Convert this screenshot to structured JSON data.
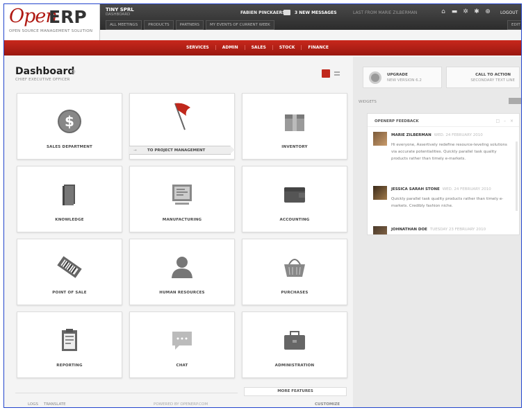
{
  "header": {
    "logo_open": "Open",
    "logo_erp": "ERP",
    "logo_tagline": "OPEN SOURCE MANAGEMENT SOLUTION",
    "db_name": "TINY SPRL",
    "db_sub": "DASHBOARD",
    "user_name": "FABIEN PINCKAERS",
    "messages": "3 NEW MESSAGES",
    "last_message": "LAST FROM MARIE ZILBERMAN",
    "logout": "LOGOUT",
    "edit": "EDIT",
    "subtabs": [
      "ALL MEETINGS",
      "PRODUCTS",
      "PARTNERS",
      "MY EVENTS OF CURRENT WEEK"
    ]
  },
  "menu": {
    "items": [
      "SERVICES",
      "ADMIN",
      "SALES",
      "STOCK",
      "FINANCE"
    ]
  },
  "dashboard": {
    "title": "Dashboard",
    "subtitle": "CHIEF EXECUTIVE OFFICER"
  },
  "tiles": [
    {
      "label": "SALES DEPARTMENT",
      "icon": "dollar-coin-icon"
    },
    {
      "label": "TO PROJECT MANAGEMENT",
      "icon": "red-flag-icon"
    },
    {
      "label": "INVENTORY",
      "icon": "box-icon"
    },
    {
      "label": "KNOWLEDGE",
      "icon": "books-icon"
    },
    {
      "label": "MANUFACTURING",
      "icon": "monitor-icon"
    },
    {
      "label": "ACCOUNTING",
      "icon": "wallet-icon"
    },
    {
      "label": "POINT OF SALE",
      "icon": "barcode-icon"
    },
    {
      "label": "HUMAN RESOURCES",
      "icon": "person-icon"
    },
    {
      "label": "PURCHASES",
      "icon": "basket-icon"
    },
    {
      "label": "REPORTING",
      "icon": "clipboard-icon"
    },
    {
      "label": "CHAT",
      "icon": "speech-bubble-icon"
    },
    {
      "label": "ADMINISTRATION",
      "icon": "briefcase-icon"
    }
  ],
  "right": {
    "upgrade_title": "UPGRADE",
    "upgrade_sub": "NEW VERSION 6.2",
    "cta_title": "CALL TO ACTION",
    "cta_sub": "SECONDARY TEXT LINE",
    "widgets_label": "WIDGETS",
    "feedback_title": "OPENERP FEEDBACK",
    "feedback": [
      {
        "name": "MARIE ZILBERMAN",
        "date": "WED. 24 FEBRUARY 2010",
        "body": "Hi everyone, Assertively redefine resource-leveling solutions via accurate potentialities. Quickly parallel task quality products rather than timely e-markets."
      },
      {
        "name": "JESSICA SARAH STONE",
        "date": "WED. 24 FEBRUARY 2010",
        "body": "Quickly parallel task quality products rather than timely e-markets. Credibly fashion niche."
      },
      {
        "name": "JOHNATHAN DOE",
        "date": "TUESDAY 23 FEBRUARY 2010",
        "body": ""
      }
    ]
  },
  "footer": {
    "more_features": "MORE FEATURES",
    "links": [
      "LOGS",
      "TRANSLATE"
    ],
    "powered": "POWERED BY OPENERP.COM",
    "customize": "CUSTOMIZE"
  }
}
